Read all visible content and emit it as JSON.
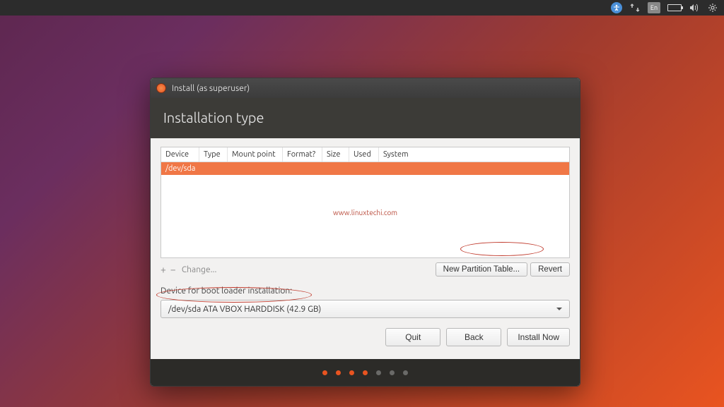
{
  "panel": {
    "lang": "En"
  },
  "window": {
    "title": "Install (as superuser)",
    "heading": "Installation type"
  },
  "table": {
    "headers": [
      "Device",
      "Type",
      "Mount point",
      "Format?",
      "Size",
      "Used",
      "System"
    ],
    "rows": [
      {
        "device": "/dev/sda"
      }
    ],
    "watermark": "www.linuxtechi.com"
  },
  "actions": {
    "plus": "+",
    "minus": "−",
    "change": "Change...",
    "new_table": "New Partition Table...",
    "revert": "Revert"
  },
  "bootloader": {
    "label": "Device for boot loader installation:",
    "selected": "/dev/sda ATA VBOX HARDDISK (42.9 GB)"
  },
  "buttons": {
    "quit": "Quit",
    "back": "Back",
    "install": "Install Now"
  }
}
